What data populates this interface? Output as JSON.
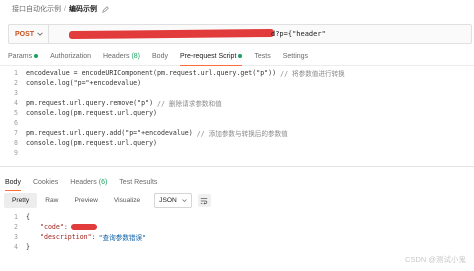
{
  "breadcrumb": {
    "parent": "接口自动化示例",
    "separator": "/",
    "current": "编码示例"
  },
  "request": {
    "method": "POST",
    "url_suffix": "d?p={\"header\""
  },
  "request_tabs": [
    {
      "label": "Params",
      "dot": true
    },
    {
      "label": "Authorization"
    },
    {
      "label": "Headers",
      "count": "(8)"
    },
    {
      "label": "Body"
    },
    {
      "label": "Pre-request Script",
      "dot": true,
      "active": true
    },
    {
      "label": "Tests"
    },
    {
      "label": "Settings"
    }
  ],
  "script": {
    "line_numbers": [
      "1",
      "2",
      "3",
      "4",
      "5",
      "6",
      "7",
      "8",
      "9"
    ],
    "lines": {
      "l1_code": "encodevalue = encodeURIComponent(pm.request.url.query.get(\"p\"))",
      "l1_comment": "// 将参数值进行转换",
      "l2_code": "console.log(\"p=\"+encodevalue)",
      "l4_code": "pm.request.url.query.remove(\"p\")",
      "l4_comment": "// 删除请求参数和值",
      "l5_code": "console.log(pm.request.url.query)",
      "l7_code": "pm.request.url.query.add(\"p=\"+encodevalue)",
      "l7_comment": "// 添加参数与转换后的参数值",
      "l8_code": "console.log(pm.request.url.query)"
    }
  },
  "response_tabs": [
    {
      "label": "Body",
      "active": true
    },
    {
      "label": "Cookies"
    },
    {
      "label": "Headers",
      "count": "(6)"
    },
    {
      "label": "Test Results"
    }
  ],
  "view_toolbar": {
    "buttons": [
      "Pretty",
      "Raw",
      "Preview",
      "Visualize"
    ],
    "active": "Pretty",
    "format": "JSON"
  },
  "response_body": {
    "line_numbers": [
      "1",
      "2",
      "3",
      "4"
    ],
    "open_brace": "{",
    "close_brace": "}",
    "code_key": "\"code\":",
    "description_key": "\"description\":",
    "description_value": "\"查询参数错误\""
  },
  "watermark": "CSDN @测试小鬼",
  "colors": {
    "accent": "#ff6c37",
    "method": "#c9521f",
    "dot": "#1aa260",
    "redaction": "#e23b3b"
  }
}
